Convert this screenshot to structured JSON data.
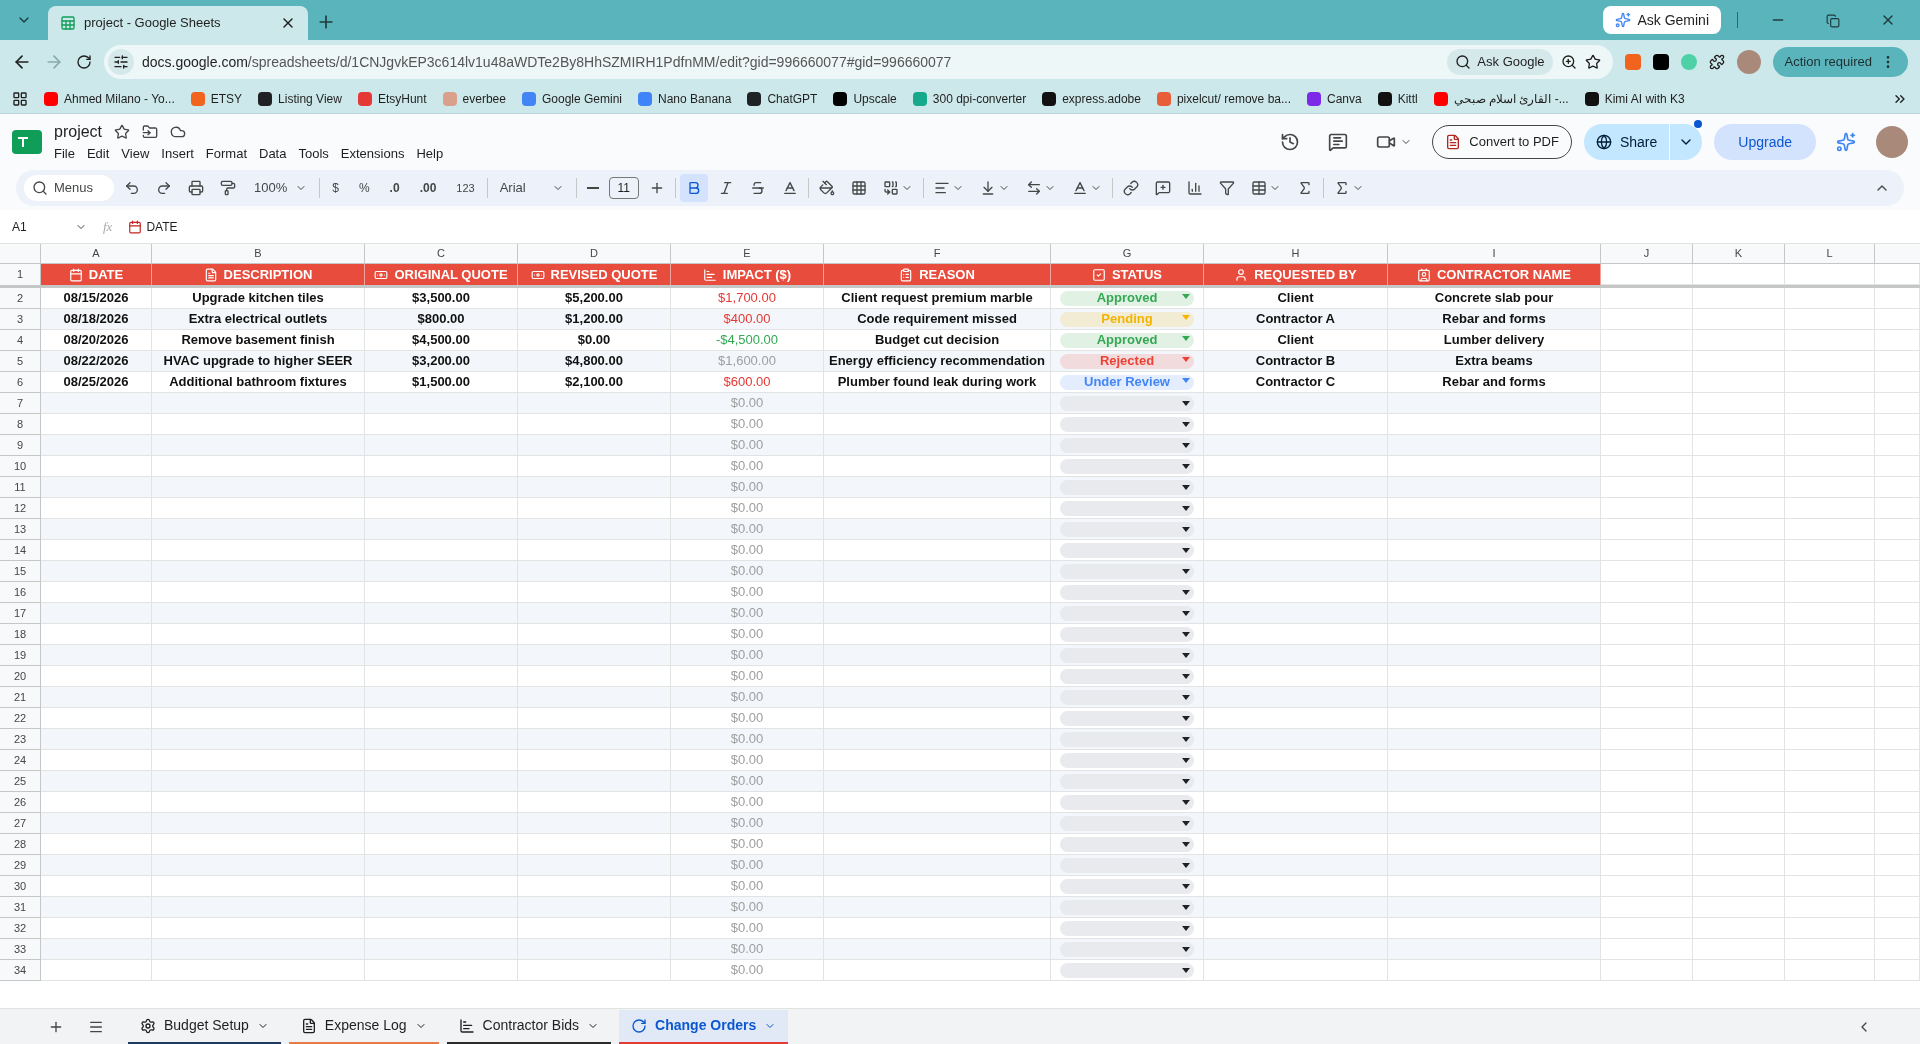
{
  "browser": {
    "tab_title": "project - Google Sheets",
    "ask_gemini": "Ask Gemini",
    "url_host": "docs.google.com",
    "url_path": "/spreadsheets/d/1CNJgvkEP3c614lv1u48aWDTe2By8HhSZMIRH1PdfnMM/edit?gid=996660077#gid=996660077",
    "ask_google": "Ask Google",
    "action_required": "Action required"
  },
  "bookmarks": [
    {
      "label": "Ahmed Milano - Yo...",
      "color": "#ff0000"
    },
    {
      "label": "ETSY",
      "color": "#f1641e"
    },
    {
      "label": "Listing View",
      "color": "#202124"
    },
    {
      "label": "EtsyHunt",
      "color": "#e53935"
    },
    {
      "label": "everbee",
      "color": "#d9a08b"
    },
    {
      "label": "Google Gemini",
      "color": "#4285f4"
    },
    {
      "label": "Nano Banana",
      "color": "#3f83f8"
    },
    {
      "label": "ChatGPT",
      "color": "#202124"
    },
    {
      "label": "Upscale",
      "color": "#000000"
    },
    {
      "label": "300 dpi-converter",
      "color": "#17a98b"
    },
    {
      "label": "express.adobe",
      "color": "#111111"
    },
    {
      "label": "pixelcut/ remove ba...",
      "color": "#e85d3a"
    },
    {
      "label": "Canva",
      "color": "#7d2ae8"
    },
    {
      "label": "Kittl",
      "color": "#111111"
    },
    {
      "label": "القارئ اسلام صبحي -...",
      "color": "#ff0000"
    },
    {
      "label": "Kimi AI with K3",
      "color": "#111111"
    }
  ],
  "doc": {
    "title": "project",
    "menus": [
      "File",
      "Edit",
      "View",
      "Insert",
      "Format",
      "Data",
      "Tools",
      "Extensions",
      "Help"
    ],
    "convert": "Convert to PDF",
    "share": "Share",
    "upgrade": "Upgrade"
  },
  "toolbar": {
    "search": "Menus",
    "zoom": "100%",
    "currency": "$",
    "percent": "%",
    "dec_less": ".0",
    "dec_more": ".00",
    "format": "123",
    "font": "Arial",
    "size": "11",
    "bold_on": true
  },
  "formula": {
    "cell": "A1",
    "fx": "fx",
    "value": "DATE"
  },
  "header_row_number": "1",
  "columns": [
    "A",
    "B",
    "C",
    "D",
    "E",
    "F",
    "G",
    "H",
    "I",
    "J",
    "K",
    "L"
  ],
  "headers": [
    "DATE",
    "DESCRIPTION",
    "ORIGINAL QUOTE",
    "REVISED QUOTE",
    "IMPACT ($)",
    "REASON",
    "STATUS",
    "REQUESTED BY",
    "CONTRACTOR NAME"
  ],
  "rows": [
    {
      "number": "2",
      "date": "08/15/2026",
      "description": "Upgrade kitchen tiles",
      "original": "$3,500.00",
      "revised": "$5,200.00",
      "impact": {
        "text": "$1,700.00",
        "color": "#e53935"
      },
      "reason": "Client request premium marble",
      "status": {
        "label": "Approved",
        "color": "#34a853"
      },
      "requested_by": "Client",
      "contractor": "Concrete slab pour"
    },
    {
      "number": "3",
      "date": "08/18/2026",
      "description": "Extra electrical outlets",
      "original": "$800.00",
      "revised": "$1,200.00",
      "impact": {
        "text": "$400.00",
        "color": "#e53935"
      },
      "reason": "Code requirement missed",
      "status": {
        "label": "Pending",
        "color": "#f4b400"
      },
      "requested_by": "Contractor A",
      "contractor": "Rebar and forms"
    },
    {
      "number": "4",
      "date": "08/20/2026",
      "description": "Remove basement finish",
      "original": "$4,500.00",
      "revised": "$0.00",
      "impact": {
        "text": "-$4,500.00",
        "color": "#34a853"
      },
      "reason": "Budget cut decision",
      "status": {
        "label": "Approved",
        "color": "#34a853"
      },
      "requested_by": "Client",
      "contractor": "Lumber delivery"
    },
    {
      "number": "5",
      "date": "08/22/2026",
      "description": "HVAC upgrade to higher SEER",
      "original": "$3,200.00",
      "revised": "$4,800.00",
      "impact": {
        "text": "$1,600.00",
        "color": "#9e9e9e"
      },
      "reason": "Energy efficiency recommendation",
      "status": {
        "label": "Rejected",
        "color": "#ea4335"
      },
      "requested_by": "Contractor B",
      "contractor": "Extra beams"
    },
    {
      "number": "6",
      "date": "08/25/2026",
      "description": "Additional bathroom fixtures",
      "original": "$1,500.00",
      "revised": "$2,100.00",
      "impact": {
        "text": "$600.00",
        "color": "#e53935"
      },
      "reason": "Plumber found leak during work",
      "status": {
        "label": "Under Review",
        "color": "#4285f4"
      },
      "requested_by": "Contractor C",
      "contractor": "Rebar and forms"
    },
    {
      "number": "7",
      "impact": {
        "text": "$0.00",
        "color": "#9e9e9e"
      }
    },
    {
      "number": "8",
      "impact": {
        "text": "$0.00",
        "color": "#9e9e9e"
      }
    },
    {
      "number": "9",
      "impact": {
        "text": "$0.00",
        "color": "#9e9e9e"
      }
    },
    {
      "number": "10",
      "impact": {
        "text": "$0.00",
        "color": "#9e9e9e"
      }
    },
    {
      "number": "11",
      "impact": {
        "text": "$0.00",
        "color": "#9e9e9e"
      }
    },
    {
      "number": "12",
      "impact": {
        "text": "$0.00",
        "color": "#9e9e9e"
      }
    },
    {
      "number": "13",
      "impact": {
        "text": "$0.00",
        "color": "#9e9e9e"
      }
    },
    {
      "number": "14",
      "impact": {
        "text": "$0.00",
        "color": "#9e9e9e"
      }
    },
    {
      "number": "15",
      "impact": {
        "text": "$0.00",
        "color": "#9e9e9e"
      }
    },
    {
      "number": "16",
      "impact": {
        "text": "$0.00",
        "color": "#9e9e9e"
      }
    },
    {
      "number": "17",
      "impact": {
        "text": "$0.00",
        "color": "#9e9e9e"
      }
    },
    {
      "number": "18",
      "impact": {
        "text": "$0.00",
        "color": "#9e9e9e"
      }
    },
    {
      "number": "19",
      "impact": {
        "text": "$0.00",
        "color": "#9e9e9e"
      }
    },
    {
      "number": "20",
      "impact": {
        "text": "$0.00",
        "color": "#9e9e9e"
      }
    },
    {
      "number": "21",
      "impact": {
        "text": "$0.00",
        "color": "#9e9e9e"
      }
    },
    {
      "number": "22",
      "impact": {
        "text": "$0.00",
        "color": "#9e9e9e"
      }
    },
    {
      "number": "23",
      "impact": {
        "text": "$0.00",
        "color": "#9e9e9e"
      }
    },
    {
      "number": "24",
      "impact": {
        "text": "$0.00",
        "color": "#9e9e9e"
      }
    },
    {
      "number": "25",
      "impact": {
        "text": "$0.00",
        "color": "#9e9e9e"
      }
    },
    {
      "number": "26",
      "impact": {
        "text": "$0.00",
        "color": "#9e9e9e"
      }
    },
    {
      "number": "27",
      "impact": {
        "text": "$0.00",
        "color": "#9e9e9e"
      }
    },
    {
      "number": "28",
      "impact": {
        "text": "$0.00",
        "color": "#9e9e9e"
      }
    },
    {
      "number": "29",
      "impact": {
        "text": "$0.00",
        "color": "#9e9e9e"
      }
    },
    {
      "number": "30",
      "impact": {
        "text": "$0.00",
        "color": "#9e9e9e"
      }
    },
    {
      "number": "31",
      "impact": {
        "text": "$0.00",
        "color": "#9e9e9e"
      }
    },
    {
      "number": "32",
      "impact": {
        "text": "$0.00",
        "color": "#9e9e9e"
      }
    },
    {
      "number": "33",
      "impact": {
        "text": "$0.00",
        "color": "#9e9e9e"
      }
    },
    {
      "number": "34",
      "impact": {
        "text": "$0.00",
        "color": "#9e9e9e"
      }
    }
  ],
  "sheet_tabs": [
    {
      "label": "Budget Setup",
      "selected": false,
      "color": "#1f3a5f"
    },
    {
      "label": "Expense Log",
      "selected": false,
      "color": "#e8794a"
    },
    {
      "label": "Contractor Bids",
      "selected": false,
      "color": "#2b2b2b"
    },
    {
      "label": "Change Orders",
      "selected": true,
      "color": "#e53935"
    }
  ]
}
